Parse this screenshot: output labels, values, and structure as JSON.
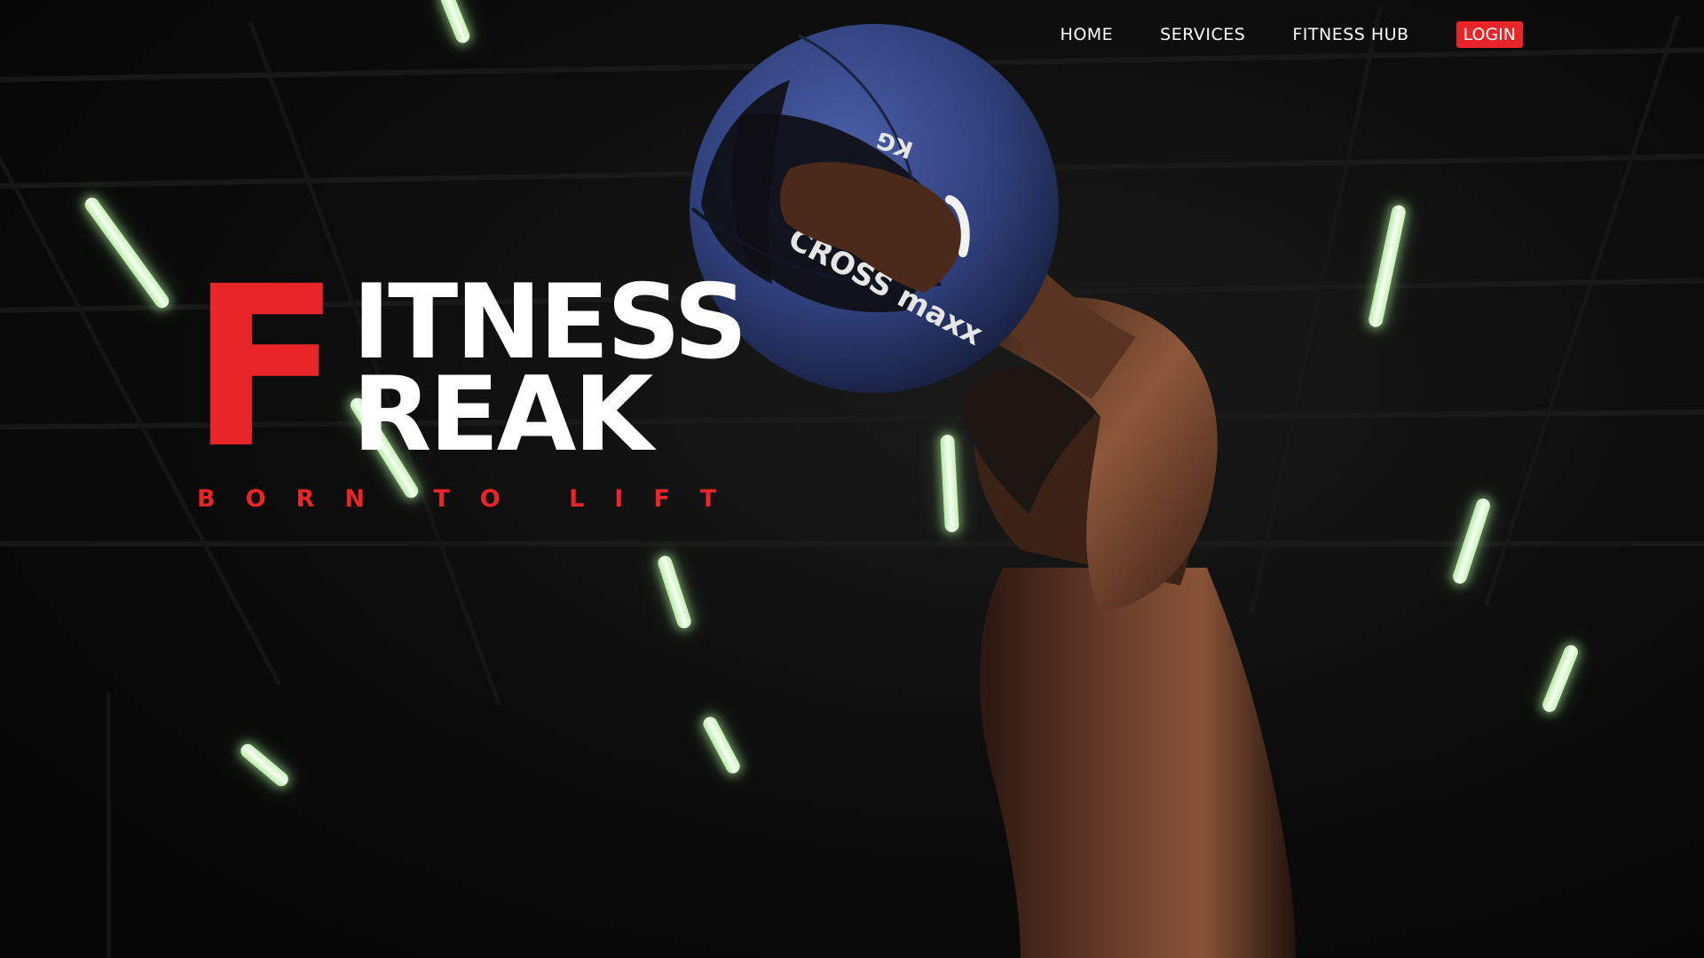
{
  "nav": {
    "items": [
      "HOME",
      "SERVICES",
      "FITNESS HUB"
    ],
    "login_label": "LOGIN"
  },
  "hero": {
    "logo_initial": "F",
    "logo_line1": "ITNESS",
    "logo_line2": "REAK",
    "tagline": "BORN TO LIFT",
    "ball_text_brand": "CROSS maxx",
    "ball_text_weight": "KG"
  },
  "colors": {
    "accent": "#e8262a",
    "text": "#ffffff",
    "background": "#070707",
    "ball": "#2f3f7a"
  }
}
